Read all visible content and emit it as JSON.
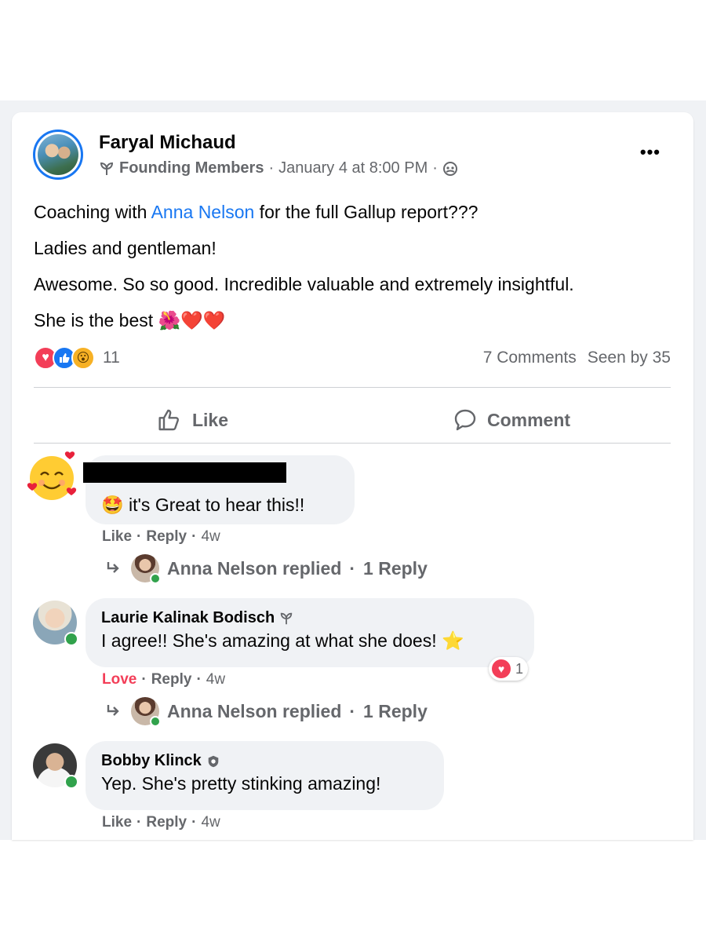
{
  "post": {
    "author": "Faryal Michaud",
    "group_badge": "Founding Members",
    "separator": "·",
    "timestamp": "January 4 at 8:00 PM",
    "more_label": "•••",
    "text": {
      "line1_before": "Coaching with ",
      "line1_mention": "Anna Nelson",
      "line1_after": " for the full Gallup report???",
      "line2": "Ladies and gentleman!",
      "line3": "Awesome. So so good. Incredible valuable and extremely insightful.",
      "line4": "She is the best ",
      "line4_emoji": "🌺❤️❤️"
    },
    "reaction_count": "11",
    "comments_count": "7 Comments",
    "seen_by": "Seen by 35"
  },
  "actions": {
    "like": "Like",
    "comment": "Comment"
  },
  "comments": [
    {
      "text": "it's Great to hear this!!",
      "emoji": "🤩",
      "like": "Like",
      "reply": "Reply",
      "time": "4w",
      "replied_by": "Anna Nelson replied",
      "reply_count": "1 Reply"
    },
    {
      "name": "Laurie Kalinak Bodisch",
      "text": "I agree!! She's amazing at what she does!",
      "emoji": "⭐",
      "reaction": "Love",
      "reply": "Reply",
      "time": "4w",
      "reaction_badge_count": "1",
      "replied_by": "Anna Nelson replied",
      "reply_count": "1 Reply"
    },
    {
      "name": "Bobby Klinck",
      "text": "Yep. She's pretty stinking amazing!",
      "like": "Like",
      "reply": "Reply",
      "time": "4w"
    }
  ],
  "colors": {
    "accent": "#1877f2",
    "love": "#f33e58",
    "online": "#31a24c",
    "muted": "#65676b"
  }
}
